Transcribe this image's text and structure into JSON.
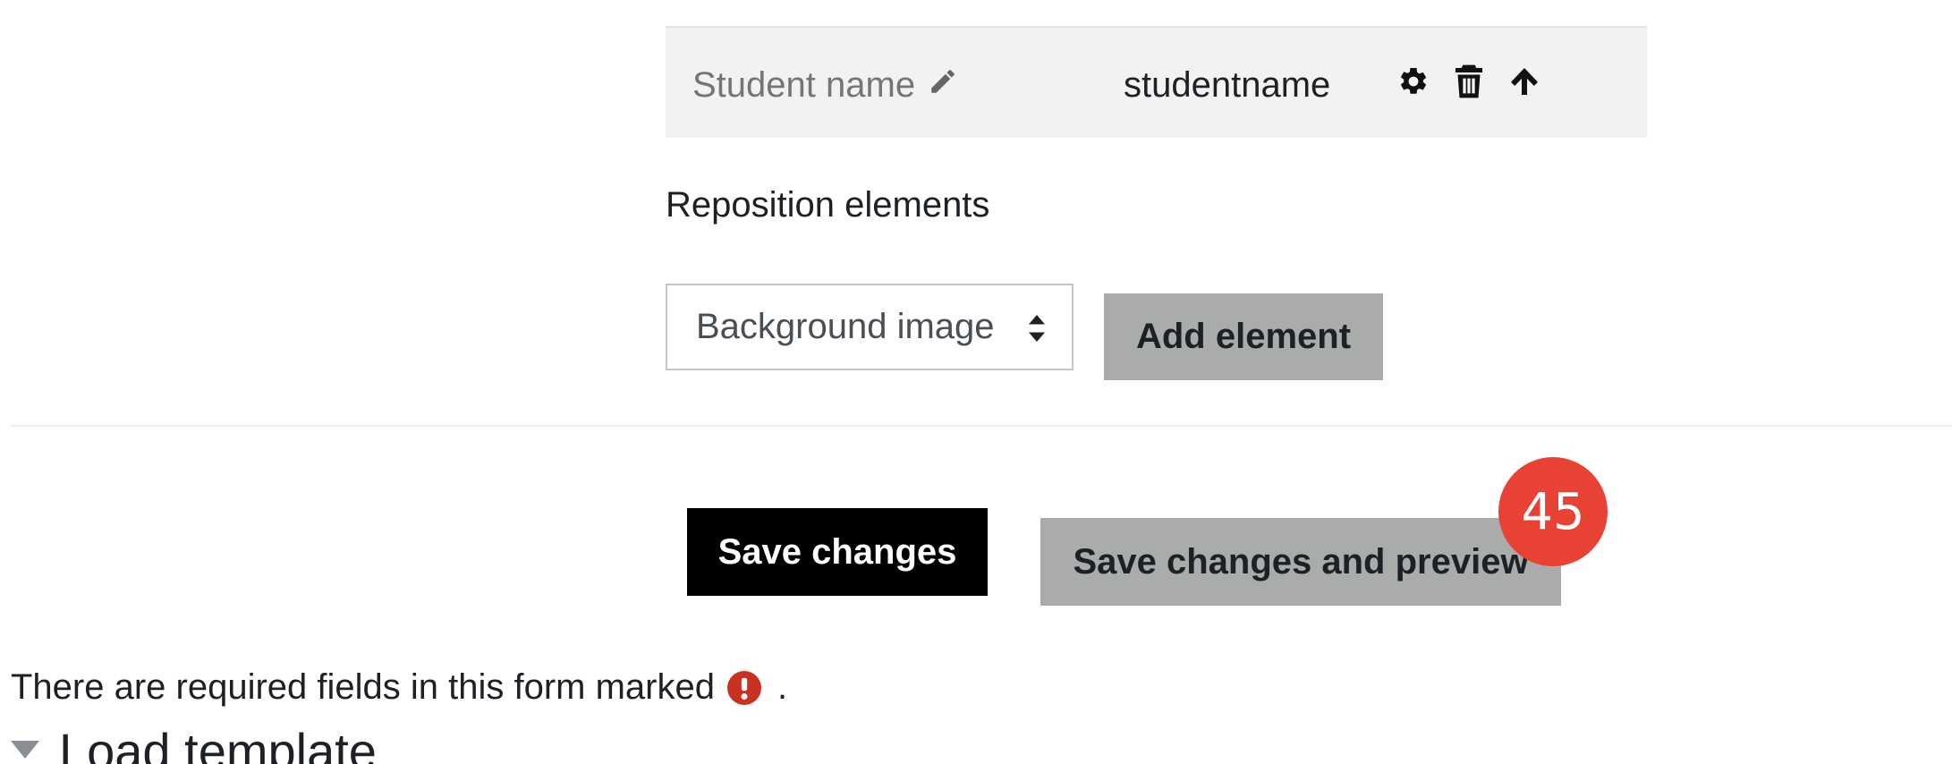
{
  "element_row": {
    "name": "Student name",
    "type": "studentname",
    "actions": {
      "edit": "pencil-icon",
      "settings": "gear-icon",
      "delete": "trash-icon",
      "move_up": "arrow-up-icon"
    }
  },
  "reposition_link": "Reposition elements",
  "element_select": {
    "value": "Background image"
  },
  "buttons": {
    "add_element": "Add element",
    "save_changes": "Save changes",
    "save_and_preview": "Save changes and preview"
  },
  "step_badge": "45",
  "required_note": {
    "prefix": "There are required fields in this form marked",
    "suffix": ".",
    "icon": "exclamation-circle-icon"
  },
  "load_template": {
    "heading": "Load template",
    "icon": "caret-down-icon"
  },
  "colors": {
    "badge": "#e74234",
    "required_icon": "#ca3120",
    "primary_button": "#000000",
    "secondary_button": "#aaabab",
    "row_background": "#f2f2f2"
  }
}
